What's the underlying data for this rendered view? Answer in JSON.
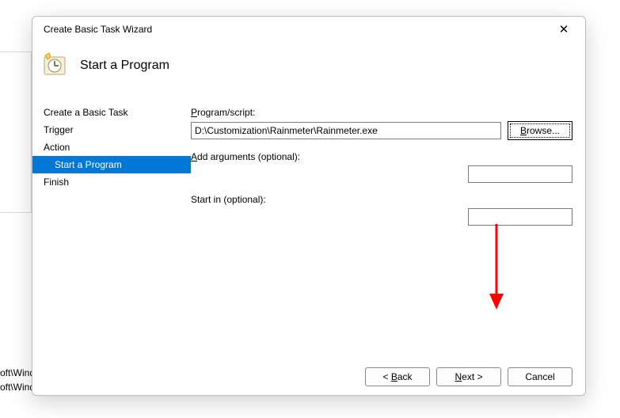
{
  "background": {
    "snips": [
      "oft\\Windo",
      "oft\\Windows\\U..."
    ]
  },
  "dialog": {
    "title": "Create Basic Task Wizard",
    "page_heading": "Start a Program",
    "sidebar": {
      "steps": [
        {
          "label": "Create a Basic Task",
          "sub": false,
          "active": false
        },
        {
          "label": "Trigger",
          "sub": false,
          "active": false
        },
        {
          "label": "Action",
          "sub": false,
          "active": false
        },
        {
          "label": "Start a Program",
          "sub": true,
          "active": true
        },
        {
          "label": "Finish",
          "sub": false,
          "active": false
        }
      ]
    },
    "form": {
      "program_label_pre": "P",
      "program_label_rest": "rogram/script:",
      "program_value": "D:\\Customization\\Rainmeter\\Rainmeter.exe",
      "browse_label": "Browse...",
      "args_label_pre": "A",
      "args_label_rest": "dd arguments (optional):",
      "args_value": "",
      "startin_label": "Start in (optional):",
      "startin_value": ""
    },
    "footer": {
      "back_pre": "< ",
      "back_u": "B",
      "back_rest": "ack",
      "next_u": "N",
      "next_rest": "ext >",
      "cancel": "Cancel"
    }
  }
}
